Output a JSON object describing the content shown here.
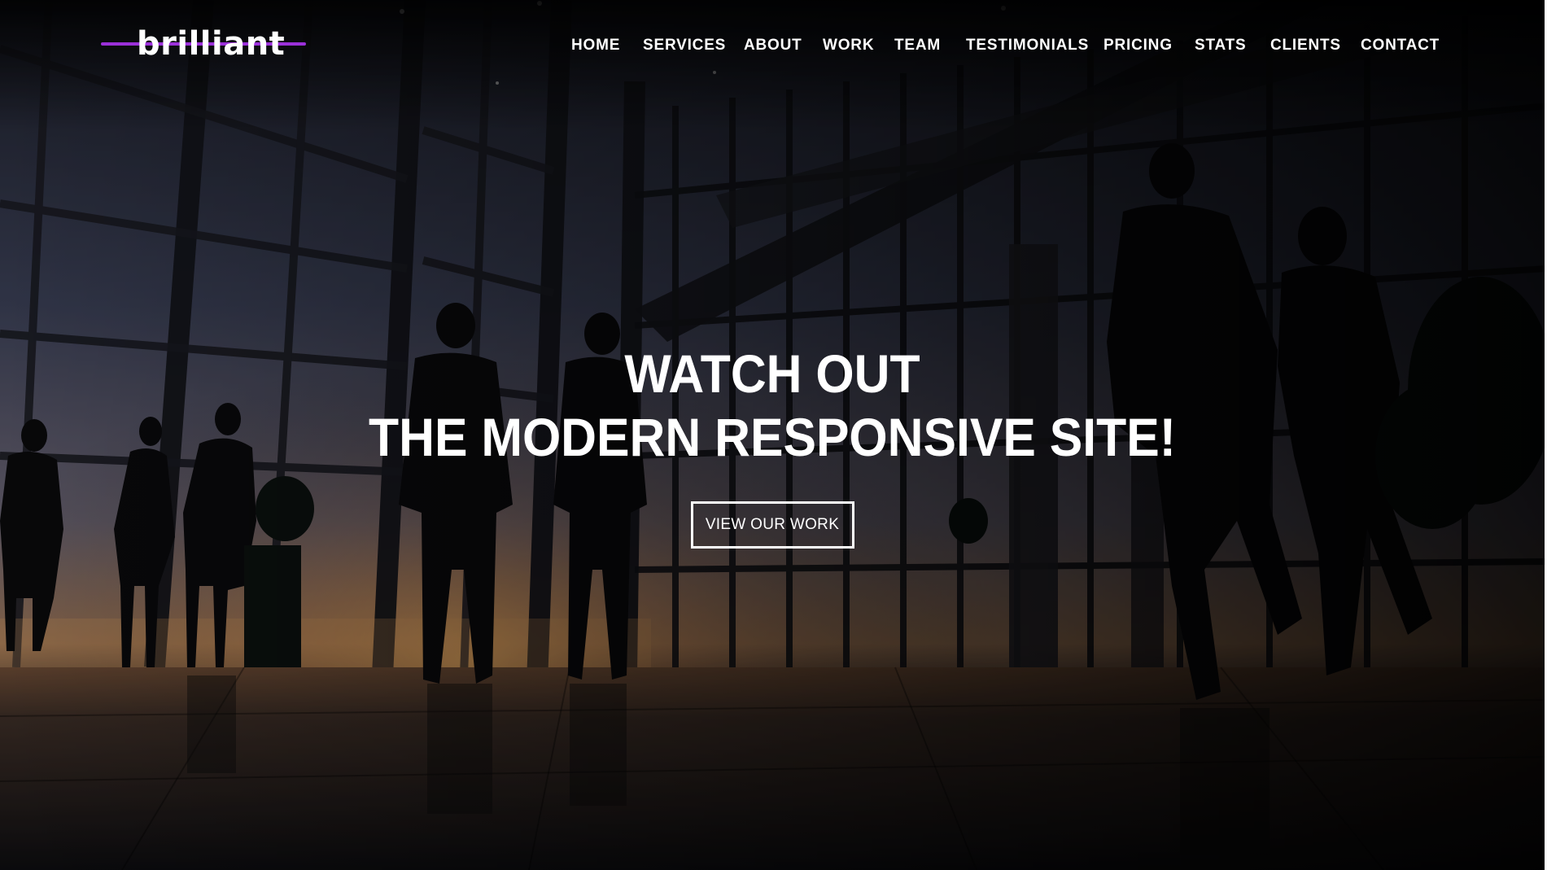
{
  "brand": {
    "logo_text": "brilliant",
    "accent_color": "#9b30d9"
  },
  "nav": {
    "items": [
      {
        "label": "HOME"
      },
      {
        "label": "SERVICES"
      },
      {
        "label": "ABOUT"
      },
      {
        "label": "WORK"
      },
      {
        "label": "TEAM"
      },
      {
        "label": "TESTIMONIALS"
      },
      {
        "label": "PRICING"
      },
      {
        "label": "STATS"
      },
      {
        "label": "CLIENTS"
      },
      {
        "label": "CONTACT"
      }
    ]
  },
  "hero": {
    "headline_line1": "WATCH OUT",
    "headline_line2": "THE MODERN RESPONSIVE SITE!",
    "cta_label": "VIEW OUR WORK",
    "background_image": "business-people-silhouettes-in-glass-lobby-at-sunset"
  }
}
